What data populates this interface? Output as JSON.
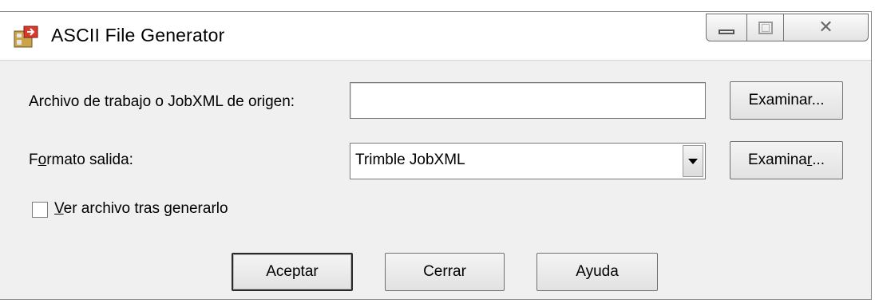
{
  "window": {
    "title": "ASCII File Generator",
    "caption_buttons": {
      "minimize_icon": "minimize-icon",
      "maximize_icon": "maximize-icon",
      "close_icon": "close-icon",
      "close_glyph": "✕"
    }
  },
  "form": {
    "source_label": "Archivo de trabajo o JobXML de origen:",
    "source_value": "",
    "source_browse_label": "Examinar...",
    "format_label_pre": "F",
    "format_label_accel": "o",
    "format_label_post": "rmato salida:",
    "format_selected": "Trimble JobXML",
    "format_browse_pre": "Examina",
    "format_browse_accel": "r",
    "format_browse_post": "...",
    "view_checkbox_accel": "V",
    "view_checkbox_rest": "er archivo tras generarlo",
    "view_checked": false
  },
  "buttons": {
    "accept": "Aceptar",
    "close": "Cerrar",
    "help": "Ayuda"
  },
  "colors": {
    "dialog_bg": "#f0f0f0",
    "titlebar_bg": "#ffffff"
  }
}
